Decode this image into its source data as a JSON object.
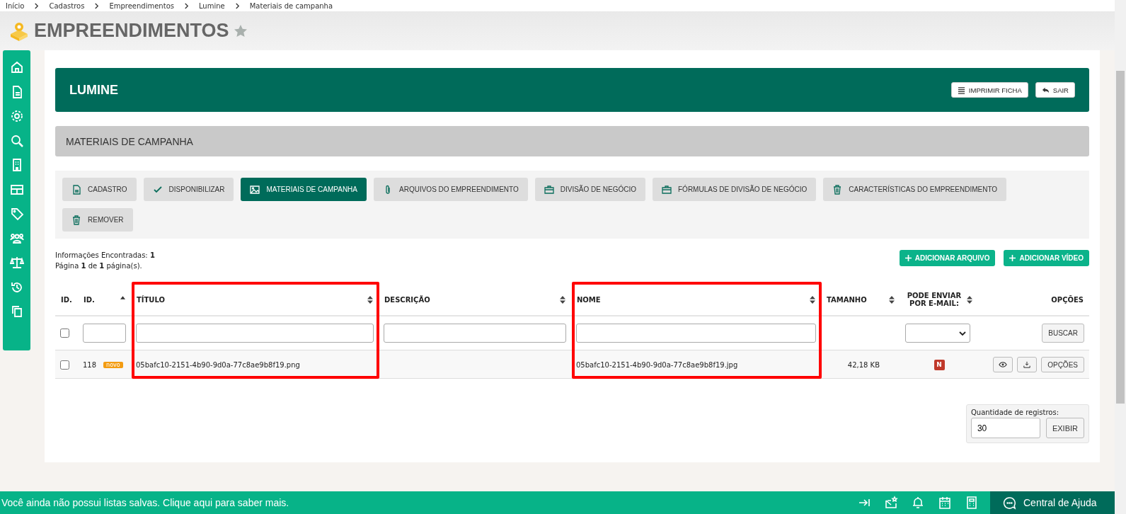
{
  "breadcrumb": [
    "Início",
    "Cadastros",
    "Empreendimentos",
    "Lumine",
    "Materiais de campanha"
  ],
  "page_title": "EMPREENDIMENTOS",
  "favorite": false,
  "record": {
    "title": "LUMINE",
    "actions": [
      "IMPRIMIR FICHA",
      "SAIR"
    ]
  },
  "section_title": "MATERIAIS DE CAMPANHA",
  "tabs": [
    {
      "label": "CADASTRO",
      "selected": false
    },
    {
      "label": "DISPONIBILIZAR",
      "selected": false
    },
    {
      "label": "MATERIAIS DE CAMPANHA",
      "selected": true
    },
    {
      "label": "ARQUIVOS DO EMPREENDIMENTO",
      "selected": false
    },
    {
      "label": "DIVISÃO DE NEGÓCIO",
      "selected": false
    },
    {
      "label": "FÓRMULAS DE DIVISÃO DE NEGÓCIO",
      "selected": false
    },
    {
      "label": "CARACTERÍSTICAS DO EMPREENDIMENTO",
      "selected": false
    },
    {
      "label": "REMOVER",
      "selected": false
    }
  ],
  "summary": [
    "Informações Encontradas: **1**",
    "Página **1** de **1** página(s)."
  ],
  "add_buttons": [
    "ADICIONAR ARQUIVO",
    "ADICIONAR VÍDEO"
  ],
  "table": {
    "columns": [
      {
        "label": "ID.",
        "kind": "checkbox",
        "sortable": false,
        "sorted": false,
        "highlighted": false
      },
      {
        "label": "ID.",
        "kind": "text",
        "sortable": true,
        "sorted": true,
        "highlighted": false
      },
      {
        "label": "TÍTULO",
        "kind": "text",
        "sortable": true,
        "sorted": false,
        "highlighted": true
      },
      {
        "label": "DESCRIÇÃO",
        "kind": "text",
        "sortable": true,
        "sorted": false,
        "highlighted": false
      },
      {
        "label": "NOME",
        "kind": "text",
        "sortable": true,
        "sorted": false,
        "highlighted": true
      },
      {
        "label": "TAMANHO",
        "kind": "plain",
        "sortable": true,
        "sorted": false,
        "highlighted": false
      },
      {
        "label": "PODE ENVIAR POR E-MAIL:",
        "kind": "select",
        "sortable": true,
        "sorted": false,
        "highlighted": false
      },
      {
        "label": "OPÇÕES",
        "kind": "button",
        "filter_label": "BUSCAR",
        "sortable": false,
        "sorted": false,
        "highlighted": false
      }
    ],
    "filter_checked": false,
    "rows": [
      {
        "checked": false,
        "id": "118",
        "badge": "novo",
        "titulo": "05bafc10-2151-4b90-9d0a-77c8ae9b8f19.png",
        "nome": "05bafc10-2151-4b90-9d0a-77c8ae9b8f19.jpg",
        "tamanho": "42,18 KB",
        "pode_enviar": "N",
        "options": "OPÇÕES"
      }
    ]
  },
  "records": {
    "label": "Quantidade de registros:",
    "value": "30",
    "button": "EXIBIR"
  },
  "footer": {
    "message": "Você ainda não possui listas salvas. Clique aqui para saber mais.",
    "help": "Central de Ajuda"
  }
}
